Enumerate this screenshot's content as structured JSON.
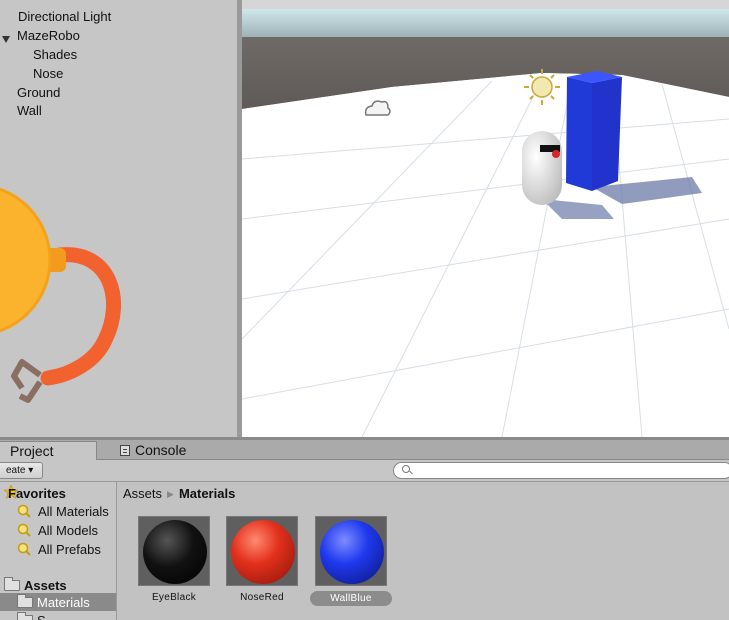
{
  "hierarchy": {
    "items": [
      {
        "label": "Directional Light"
      },
      {
        "label": "MazeRobo"
      },
      {
        "label": "Shades"
      },
      {
        "label": "Nose"
      },
      {
        "label": "Ground"
      },
      {
        "label": "Wall"
      }
    ]
  },
  "tabs": {
    "project": "Project",
    "console": "Console"
  },
  "toolbar": {
    "create_label": "eate ▾",
    "search_placeholder": ""
  },
  "tree": {
    "favorites": "Favorites",
    "all_materials": "All Materials",
    "all_models": "All Models",
    "all_prefabs": "All Prefabs",
    "assets": "Assets",
    "materials": "Materials",
    "partial": "S"
  },
  "breadcrumb": {
    "root": "Assets",
    "current": "Materials"
  },
  "assets": [
    {
      "name": "EyeBlack",
      "color": "#111111"
    },
    {
      "name": "NoseRed",
      "color": "#e2301c"
    },
    {
      "name": "WallBlue",
      "color": "#1f39ee"
    }
  ],
  "colors": {
    "mascot_orange": "#fbb22c",
    "arm_orange": "#f2622e",
    "wall_blue": "#2233cc"
  }
}
